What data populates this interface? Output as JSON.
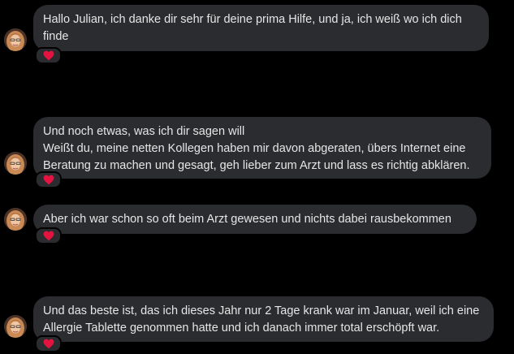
{
  "colors": {
    "background": "#000000",
    "bubble": "#2b2c2f",
    "text": "#e6e6e6",
    "heart": "#e4133f"
  },
  "messages": [
    {
      "lines": [
        "Hallo Julian, ich danke dir sehr für deine prima Hilfe, und ja, ich weiß wo ich dich",
        "finde"
      ],
      "reaction": "heart-icon"
    },
    {
      "lines": [
        "Und noch etwas, was ich dir sagen will",
        "Weißt du, meine netten Kollegen haben mir davon abgeraten, übers Internet eine",
        "Beratung zu machen und gesagt, geh lieber zum Arzt und lass es richtig abklären."
      ],
      "reaction": "heart-icon"
    },
    {
      "lines": [
        "Aber ich war schon so oft beim Arzt gewesen und nichts dabei rausbekommen"
      ],
      "reaction": "heart-icon"
    },
    {
      "lines": [
        "Und das beste ist, das ich dieses Jahr nur 2 Tage krank war im Januar, weil ich eine",
        "Allergie Tablette genommen hatte und ich danach immer total erschöpft war."
      ],
      "reaction": "heart-icon"
    }
  ]
}
